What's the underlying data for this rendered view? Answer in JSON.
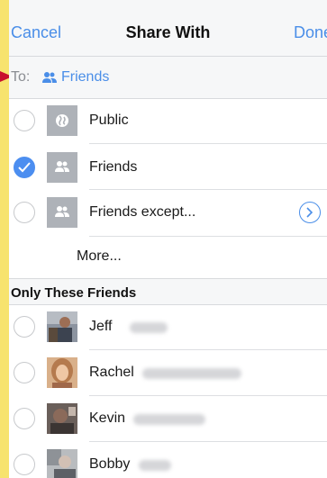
{
  "nav": {
    "cancel": "Cancel",
    "title": "Share With",
    "done": "Done"
  },
  "to": {
    "label": "To:",
    "value": "Friends"
  },
  "options": [
    {
      "label": "Public",
      "icon": "globe-icon",
      "checked": false
    },
    {
      "label": "Friends",
      "icon": "friends-icon",
      "checked": true
    },
    {
      "label": "Friends except...",
      "icon": "friends-icon",
      "checked": false
    }
  ],
  "more_label": "More...",
  "section_header": "Only These Friends",
  "friends": [
    {
      "first_name": "Jeff"
    },
    {
      "first_name": "Rachel"
    },
    {
      "first_name": "Kevin"
    },
    {
      "first_name": "Bobby"
    }
  ],
  "colors": {
    "accent": "#4a8ee8",
    "background": "#f7e36e",
    "arrow": "#c8102e"
  }
}
